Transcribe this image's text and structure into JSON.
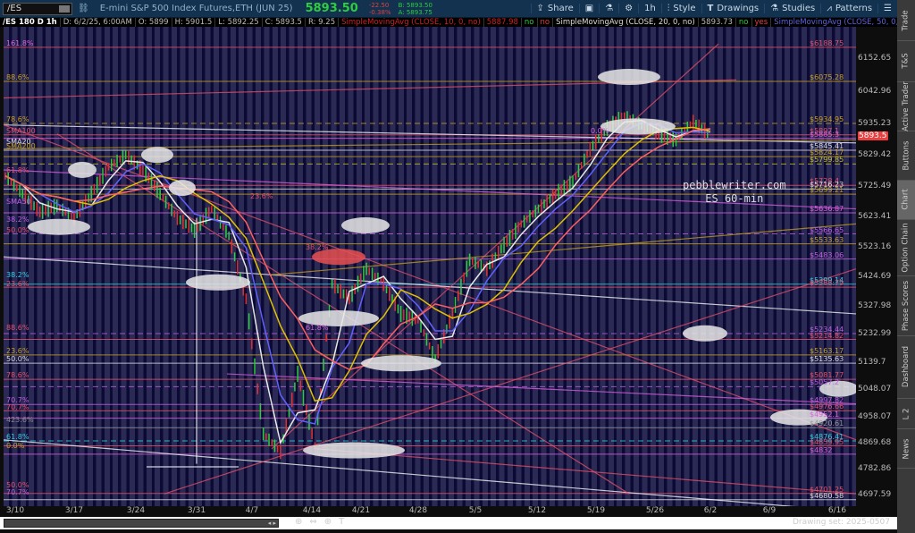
{
  "toolbar": {
    "symbol": "/ES",
    "description": "E-mini S&P 500 Index Futures,ETH (JUN 25)",
    "last": "5893.50",
    "change": "-22.50",
    "change_pct": "-0.38%",
    "bid": "B: 5893.50",
    "ask": "A: 5893.75",
    "tools": [
      "Share",
      "1h",
      "Style",
      "Drawings",
      "Studies",
      "Patterns"
    ]
  },
  "infobar": {
    "chart": "/ES 180 D 1h",
    "date": "D: 6/2/25, 6:00AM",
    "open": "O: 5899",
    "high": "H: 5901.5",
    "low": "L: 5892.25",
    "close": "C: 5893.5",
    "range": "R: 9.25",
    "sma10": "SimpleMovingAvg (CLOSE, 10, 0, no)",
    "sma10_val": "5887.98",
    "no1": "no",
    "no2": "no",
    "sma20": "SimpleMovingAvg (CLOSE, 20, 0, no)",
    "sma20_val": "5893.73",
    "no3": "no",
    "yes1": "yes",
    "sma50": "SimpleMovingAvg (CLOSE, 50, 0, no)",
    "more": "..."
  },
  "price_axis": [
    6152.65,
    6042.96,
    5935.23,
    5829.42,
    5725.49,
    5623.41,
    5523.16,
    5424.69,
    5327.98,
    5232.99,
    5139.7,
    5048.07,
    4958.07,
    4869.68,
    4782.86,
    4697.59
  ],
  "current_price": "5893.5",
  "price_levels": [
    {
      "p": 6188.75,
      "t": "$6188.75",
      "c": "#e8506a"
    },
    {
      "p": 6075.28,
      "t": "$6075.28",
      "c": "#c8a020"
    },
    {
      "p": 5934.95,
      "t": "$5934.95",
      "c": "#c8a020"
    },
    {
      "p": 5897.1,
      "t": "$5897.1",
      "c": "#e8506a"
    },
    {
      "p": 5885.3,
      "t": "$5885.3",
      "c": "#e060e0"
    },
    {
      "p": 5845.41,
      "t": "$5845.41",
      "c": "#dddddd"
    },
    {
      "p": 5824.17,
      "t": "$5824.17",
      "c": "#c8a020"
    },
    {
      "p": 5799.85,
      "t": "$5799.85",
      "c": "#c8c020"
    },
    {
      "p": 5728.4,
      "t": "$5728.4",
      "c": "#e8506a"
    },
    {
      "p": 5716.23,
      "t": "$5716.23",
      "c": "#dddddd"
    },
    {
      "p": 5699.21,
      "t": "$5699.21",
      "c": "#c8a020"
    },
    {
      "p": 5636.87,
      "t": "$5636.87",
      "c": "#e060e0"
    },
    {
      "p": 5566.65,
      "t": "$5566.65",
      "c": "#c060e0"
    },
    {
      "p": 5533.63,
      "t": "$5533.63",
      "c": "#c8a020"
    },
    {
      "p": 5483.06,
      "t": "$5483.06",
      "c": "#c060e0"
    },
    {
      "p": 5399.14,
      "t": "$5399.14",
      "c": "#30d0e0"
    },
    {
      "p": 5388.79,
      "t": "$5388.79",
      "c": "#e8506a"
    },
    {
      "p": 5234.44,
      "t": "$5234.44",
      "c": "#c060e0"
    },
    {
      "p": 5214.82,
      "t": "$5214.82",
      "c": "#e8506a"
    },
    {
      "p": 5163.17,
      "t": "$5163.17",
      "c": "#c8a020"
    },
    {
      "p": 5135.63,
      "t": "$5135.63",
      "c": "#dddddd"
    },
    {
      "p": 5081.77,
      "t": "$5081.77",
      "c": "#e8506a"
    },
    {
      "p": 5057.2,
      "t": "$5057.2",
      "c": "#c060e0"
    },
    {
      "p": 4997.82,
      "t": "$4997.82",
      "c": "#c060e0"
    },
    {
      "p": 4976.66,
      "t": "$4976.66",
      "c": "#e8506a"
    },
    {
      "p": 4952.1,
      "t": "$4952.1",
      "c": "#e060e0"
    },
    {
      "p": 4920.61,
      "t": "$4920.61",
      "c": "#999999"
    },
    {
      "p": 4876.41,
      "t": "$4876.41",
      "c": "#30d0e0"
    },
    {
      "p": 4859.95,
      "t": "$4859.95",
      "c": "#e8506a"
    },
    {
      "p": 4832,
      "t": "$4832",
      "c": "#e060e0"
    },
    {
      "p": 4701.25,
      "t": "$4701.25",
      "c": "#e8506a"
    },
    {
      "p": 4680.58,
      "t": "$4680.58",
      "c": "#dddddd"
    }
  ],
  "fib_labels": [
    {
      "p": 6188,
      "t": "161.8%",
      "c": "#e060e0"
    },
    {
      "p": 6075,
      "t": "88.6%",
      "c": "#c8a020"
    },
    {
      "p": 5934,
      "t": "78.6%",
      "c": "#c8a020"
    },
    {
      "p": 5897,
      "t": "SMA100",
      "c": "#e8506a"
    },
    {
      "p": 5860,
      "t": "SMA20",
      "c": "#dddddd"
    },
    {
      "p": 5845,
      "t": "SMA200",
      "c": "#c8a020"
    },
    {
      "p": 5765,
      "t": "61.8%",
      "c": "#e8506a"
    },
    {
      "p": 5660,
      "t": "SMA50",
      "c": "#c060e0"
    },
    {
      "p": 5600,
      "t": "38.2%",
      "c": "#c060e0"
    },
    {
      "p": 5566,
      "t": "50.0%",
      "c": "#e8506a"
    },
    {
      "p": 5415,
      "t": "38.2%",
      "c": "#30d0e0"
    },
    {
      "p": 5385,
      "t": "23.6%",
      "c": "#e8506a"
    },
    {
      "p": 5240,
      "t": "88.6%",
      "c": "#e8506a"
    },
    {
      "p": 5163,
      "t": "23.6%",
      "c": "#c8a020"
    },
    {
      "p": 5135,
      "t": "50.0%",
      "c": "#dddddd"
    },
    {
      "p": 5081,
      "t": "78.6%",
      "c": "#e8506a"
    },
    {
      "p": 5000,
      "t": "70.7%",
      "c": "#c060e0"
    },
    {
      "p": 4976,
      "t": "70.7%",
      "c": "#e8506a"
    },
    {
      "p": 4932,
      "t": "423.6%",
      "c": "#888888"
    },
    {
      "p": 4876,
      "t": "61.8%",
      "c": "#30d0e0"
    },
    {
      "p": 4848,
      "t": "0.0%",
      "c": "#c8a020"
    },
    {
      "p": 4715,
      "t": "50.0%",
      "c": "#e8506a"
    },
    {
      "p": 4693,
      "t": "70.7%",
      "c": "#c060e0"
    }
  ],
  "mid_labels": [
    {
      "p": 5897,
      "t": "0.0%",
      "c": "#e060e0",
      "d": "5/12"
    },
    {
      "p": 5680,
      "t": "23.6%",
      "c": "#e8506a",
      "d": "3/31"
    },
    {
      "p": 5510,
      "t": "38.2%",
      "c": "#e8506a",
      "d": "4/7"
    },
    {
      "p": 5240,
      "t": "61.8%",
      "c": "#e060e0",
      "d": "4/7"
    }
  ],
  "watermark": [
    "pebblewriter.com",
    "ES 60-min"
  ],
  "dates": [
    "3/10",
    "3/17",
    "3/24",
    "3/31",
    "4/7",
    "4/14",
    "4/21",
    "4/28",
    "5/5",
    "5/12",
    "5/19",
    "5/26",
    "6/2",
    "6/9",
    "6/16"
  ],
  "price_path": [
    5760,
    5700,
    5640,
    5660,
    5620,
    5700,
    5790,
    5830,
    5780,
    5700,
    5620,
    5580,
    5650,
    5560,
    5350,
    4900,
    4840,
    5100,
    4860,
    5400,
    5350,
    5450,
    5400,
    5300,
    5280,
    5150,
    5300,
    5480,
    5450,
    5530,
    5600,
    5650,
    5700,
    5740,
    5850,
    5920,
    5960,
    5930,
    5900,
    5880,
    5940,
    5893
  ],
  "drawing_set": "Drawing set: 2025-0507",
  "side_tabs": [
    "Trade",
    "T&S",
    "Active Trader",
    "Buttons",
    "Chart",
    "Option Chain",
    "Phase Scores",
    "Dashboard",
    "L 2",
    "News"
  ]
}
